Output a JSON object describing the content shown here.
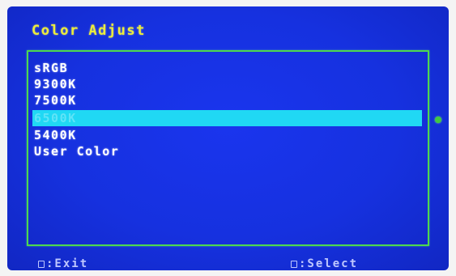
{
  "osd": {
    "title": "Color Adjust",
    "items": [
      {
        "label": "sRGB"
      },
      {
        "label": "9300K"
      },
      {
        "label": "7500K"
      },
      {
        "label": "6500K",
        "selected": true
      },
      {
        "label": "5400K"
      },
      {
        "label": "User Color"
      }
    ],
    "footer": {
      "exit_label": ":Exit",
      "select_label": ":Select"
    },
    "colors": {
      "background": "#1631df",
      "title": "#ecec3a",
      "border": "#4ed84e",
      "highlight": "#20d8f4",
      "indicator": "#42c842"
    }
  }
}
